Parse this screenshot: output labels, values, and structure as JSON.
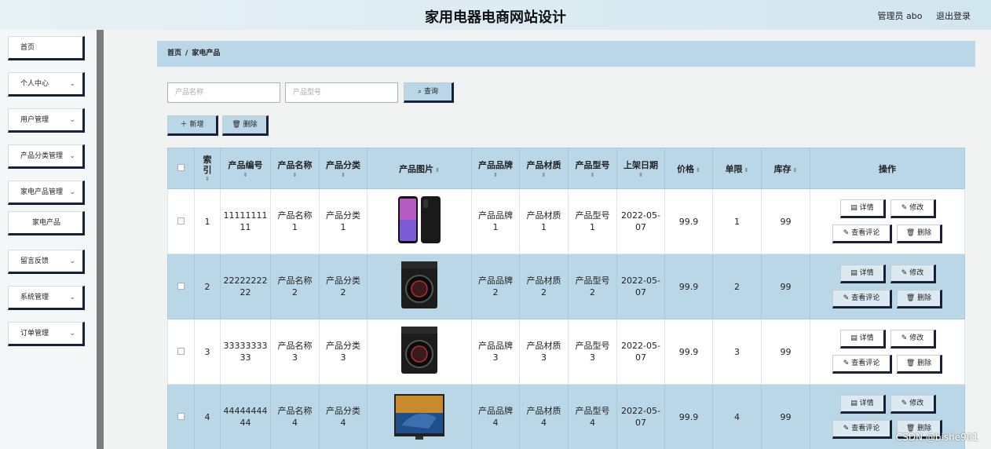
{
  "header": {
    "title": "家用电器电商网站设计",
    "user": "管理员 abo",
    "logout": "退出登录"
  },
  "sidebar": {
    "items": [
      {
        "label": "首页",
        "chevron": false
      },
      {
        "label": "个人中心",
        "chevron": true
      },
      {
        "label": "用户管理",
        "chevron": true
      },
      {
        "label": "产品分类管理",
        "chevron": true
      },
      {
        "label": "家电产品管理",
        "chevron": true
      },
      {
        "label": "家电产品",
        "chevron": false,
        "sub": true
      },
      {
        "label": "留言反馈",
        "chevron": true
      },
      {
        "label": "系统管理",
        "chevron": true
      },
      {
        "label": "订单管理",
        "chevron": true
      }
    ]
  },
  "breadcrumb": {
    "home": "首页",
    "separator": "/",
    "current": "家电产品"
  },
  "search": {
    "name_placeholder": "产品名称",
    "model_placeholder": "产品型号",
    "query_label": "查询"
  },
  "actions": {
    "add_label": "新增",
    "delete_label": "删除"
  },
  "table": {
    "headers": [
      "索引",
      "产品编号",
      "产品名称",
      "产品分类",
      "产品图片",
      "产品品牌",
      "产品材质",
      "产品型号",
      "上架日期",
      "价格",
      "单限",
      "库存",
      "操作"
    ],
    "rows": [
      {
        "index": "1",
        "code": "11111111\n11",
        "name": "产品名称\n1",
        "category": "产品分类\n1",
        "image": "phone",
        "brand": "产品品牌\n1",
        "material": "产品材质\n1",
        "model": "产品型号\n1",
        "date": "2022-05-\n07",
        "price": "99.9",
        "limit": "1",
        "stock": "99"
      },
      {
        "index": "2",
        "code": "22222222\n22",
        "name": "产品名称\n2",
        "category": "产品分类\n2",
        "image": "washer",
        "brand": "产品品牌\n2",
        "material": "产品材质\n2",
        "model": "产品型号\n2",
        "date": "2022-05-\n07",
        "price": "99.9",
        "limit": "2",
        "stock": "99"
      },
      {
        "index": "3",
        "code": "33333333\n33",
        "name": "产品名称\n3",
        "category": "产品分类\n3",
        "image": "washer",
        "brand": "产品品牌\n3",
        "material": "产品材质\n3",
        "model": "产品型号\n3",
        "date": "2022-05-\n07",
        "price": "99.9",
        "limit": "3",
        "stock": "99"
      },
      {
        "index": "4",
        "code": "44444444\n44",
        "name": "产品名称\n4",
        "category": "产品分类\n4",
        "image": "tv",
        "brand": "产品品牌\n4",
        "material": "产品材质\n4",
        "model": "产品型号\n4",
        "date": "2022-05-\n07",
        "price": "99.9",
        "limit": "4",
        "stock": "99"
      }
    ],
    "row_buttons": {
      "detail": "详情",
      "edit": "修改",
      "comments": "查看评论",
      "delete": "删除"
    }
  },
  "watermark": "CSDN @bishe901",
  "colors": {
    "accent": "#bad7e7",
    "button_shadow": "#1a1f3a",
    "sidebar_bar": "#7d7d7d"
  }
}
